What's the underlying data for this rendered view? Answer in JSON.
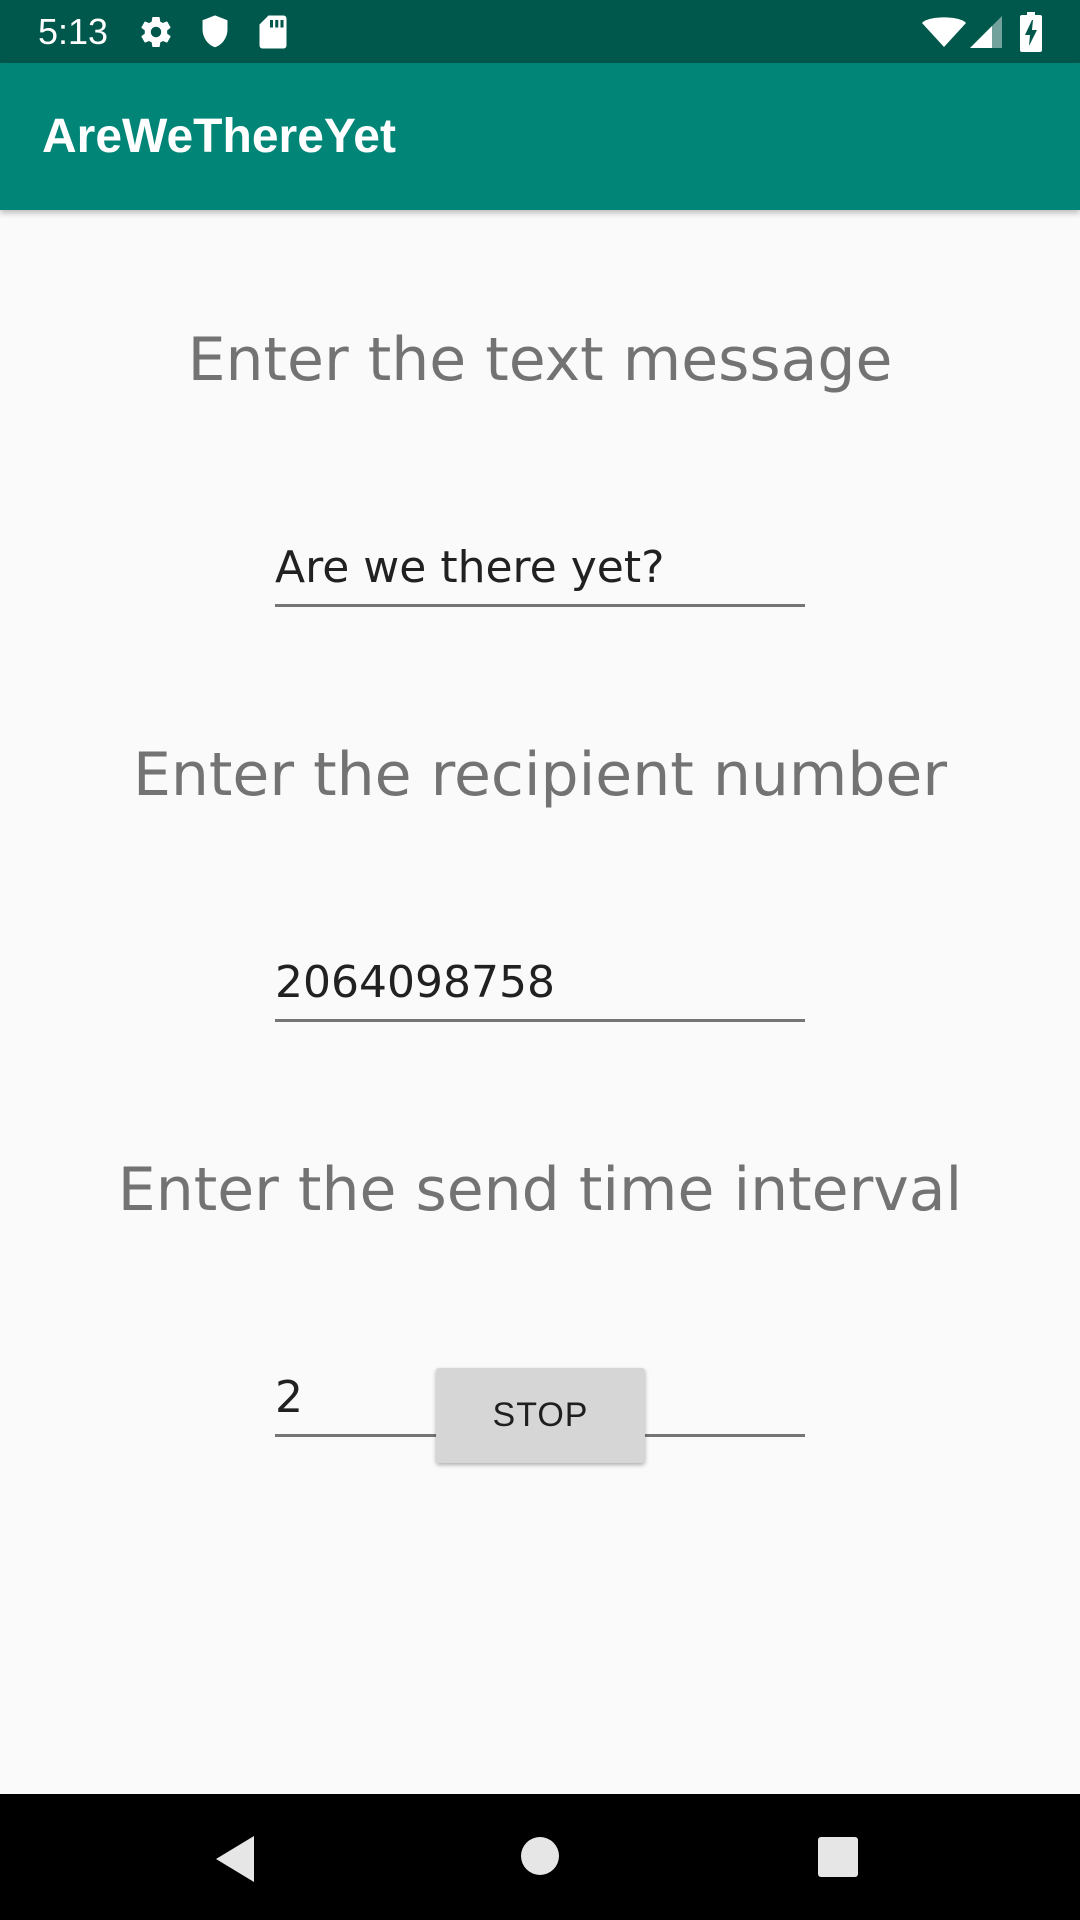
{
  "status_bar": {
    "time": "5:13",
    "left_icons": [
      "gear-icon",
      "shield-icon",
      "sd-card-icon"
    ],
    "right_icons": [
      "wifi-icon",
      "cell-signal-icon",
      "battery-charging-icon"
    ]
  },
  "app_bar": {
    "title": "AreWeThereYet",
    "color": "#008577",
    "status_color": "#00574b"
  },
  "form": {
    "message_label": "Enter the text message",
    "message_value": "Are we there yet?",
    "recipient_label": "Enter the recipient number",
    "recipient_value": "2064098758",
    "interval_label": "Enter the send time interval",
    "interval_value": "2",
    "button_label": "STOP"
  },
  "nav_bar": {
    "buttons": [
      "back-icon",
      "home-icon",
      "recents-icon"
    ]
  }
}
